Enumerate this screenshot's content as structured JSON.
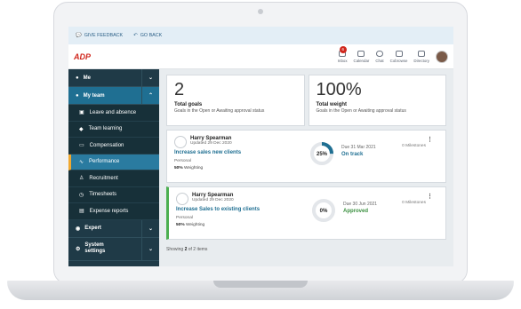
{
  "topbar": {
    "feedback_label": "GIVE FEEDBACK",
    "back_label": "GO BACK"
  },
  "appbar": {
    "logo_text": "ADP",
    "tools": [
      {
        "label": "Inbox",
        "icon": "inbox-icon",
        "badge": "6"
      },
      {
        "label": "Calendar",
        "icon": "calendar-icon"
      },
      {
        "label": "Chat",
        "icon": "chat-icon"
      },
      {
        "label": "Cobrowse",
        "icon": "cobrowse-icon"
      },
      {
        "label": "Directory",
        "icon": "directory-icon"
      }
    ]
  },
  "sidebar": {
    "me": "Me",
    "my_team": "My team",
    "sub": [
      "Leave and absence",
      "Team learning",
      "Compensation",
      "Performance",
      "Recruitment",
      "Timesheets",
      "Expense reports"
    ],
    "expert": "Expert",
    "system_settings": "System settings"
  },
  "stats": [
    {
      "num": "2",
      "label": "Total goals",
      "sub": "Goals in the Open or Awaiting approval status"
    },
    {
      "num": "100%",
      "label": "Total weight",
      "sub": "Goals in the Open or Awaiting approval status"
    }
  ],
  "goals": [
    {
      "name": "Harry Spearman",
      "updated": "Updated 29 Dec 2020",
      "title": "Increase sales new clients",
      "type": "Personal",
      "weight_value": "50%",
      "weight_label": "Weighting",
      "progress": 25,
      "progress_label": "25%",
      "due": "Due 31 Mar 2021",
      "status": "On track",
      "milestones": "0 Milestones"
    },
    {
      "name": "Harry Spearman",
      "updated": "Updated 29 Dec 2020",
      "title": "Increase Sales to existing clients",
      "type": "Personal",
      "weight_value": "50%",
      "weight_label": "Weighting",
      "progress": 0,
      "progress_label": "0%",
      "due": "Due 30 Jun 2021",
      "status": "Approved",
      "milestones": "0 Milestones"
    }
  ],
  "footer": {
    "showing_prefix": "Showing",
    "showing_count": "2",
    "showing_suffix": "of 2 items"
  },
  "colors": {
    "accent": "#1f6f92",
    "sidebar": "#1f3a47",
    "on_track": "#1f6f92",
    "approved": "#3a8f3f",
    "brand": "#d0271d"
  }
}
